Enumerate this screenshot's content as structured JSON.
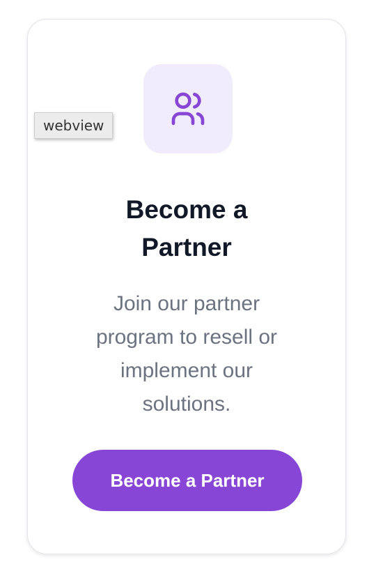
{
  "card": {
    "icon": "users-icon",
    "title": "Become a Partner",
    "description": "Join our partner program to resell or implement our solutions.",
    "button_label": "Become a Partner"
  },
  "tooltip": {
    "label": "webview"
  },
  "colors": {
    "accent": "#8746d6",
    "icon_tile_bg": "#f1ecfb",
    "title": "#111827",
    "description": "#6b7280"
  }
}
